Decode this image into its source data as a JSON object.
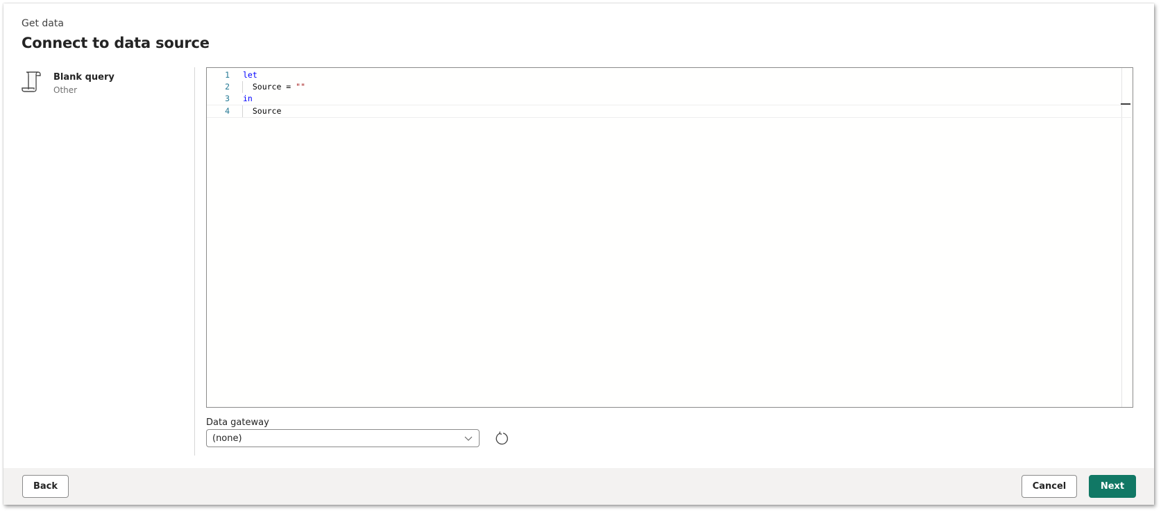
{
  "header": {
    "kicker": "Get data",
    "title": "Connect to data source"
  },
  "connector": {
    "icon": "scroll-icon",
    "name": "Blank query",
    "category": "Other"
  },
  "editor": {
    "lines": [
      {
        "number": "1",
        "tokens": [
          {
            "text": "let",
            "type": "kw"
          }
        ]
      },
      {
        "number": "2",
        "tokens": [
          {
            "text": "  Source = ",
            "type": "plain"
          },
          {
            "text": "\"\"",
            "type": "str"
          }
        ]
      },
      {
        "number": "3",
        "tokens": [
          {
            "text": "in",
            "type": "kw"
          }
        ]
      },
      {
        "number": "4",
        "tokens": [
          {
            "text": "  Source",
            "type": "plain"
          }
        ]
      }
    ],
    "current_line": 4
  },
  "gateway": {
    "label": "Data gateway",
    "value": "(none)",
    "refresh_icon": "refresh-icon",
    "dropdown_icon": "chevron-down-icon"
  },
  "footer": {
    "back_label": "Back",
    "cancel_label": "Cancel",
    "next_label": "Next"
  },
  "colors": {
    "accent": "#117865",
    "keyword": "#0000ff",
    "string": "#a31515",
    "line_number": "#237893"
  }
}
